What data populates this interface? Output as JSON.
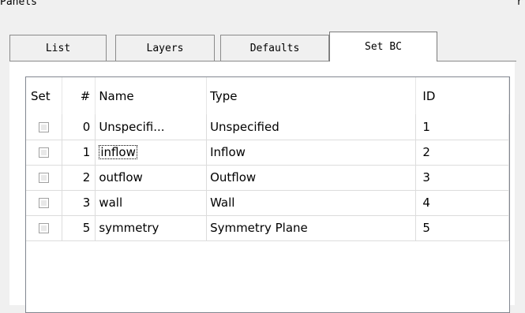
{
  "panel": {
    "title": "Panels",
    "corner_glyph": "r"
  },
  "tabs": [
    {
      "label": "List"
    },
    {
      "label": "Layers"
    },
    {
      "label": "Defaults"
    },
    {
      "label": "Set BC",
      "active": true
    }
  ],
  "table": {
    "columns": [
      "Set",
      "#",
      "Name",
      "Type",
      "ID"
    ],
    "rows": [
      {
        "num": "0",
        "name": "Unspecifi...",
        "type": "Unspecified",
        "id": "1"
      },
      {
        "num": "1",
        "name": "inflow",
        "type": "Inflow",
        "id": "2"
      },
      {
        "num": "2",
        "name": "outflow",
        "type": "Outflow",
        "id": "3"
      },
      {
        "num": "3",
        "name": "wall",
        "type": "Wall",
        "id": "4"
      },
      {
        "num": "5",
        "name": "symmetry",
        "type": "Symmetry Plane",
        "id": "5"
      }
    ]
  }
}
